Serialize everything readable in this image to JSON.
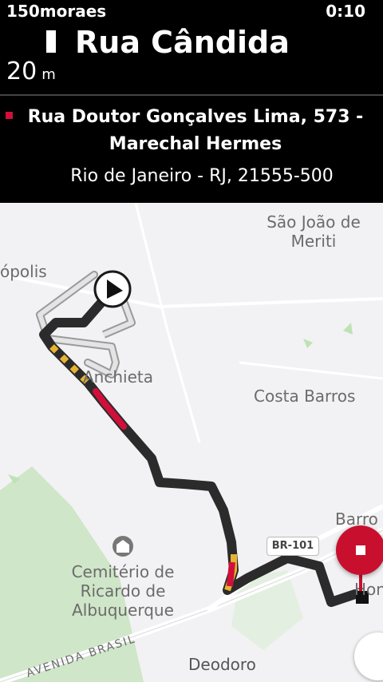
{
  "status_bar": {
    "left_text": "150moraes",
    "right_text": "0:10"
  },
  "navigation": {
    "street": "Rua Cândida",
    "distance_value": "20",
    "distance_unit": "m"
  },
  "destination": {
    "line1": "Rua Doutor Gonçalves Lima, 573 - Marechal Hermes",
    "line2": "Rio de Janeiro - RJ, 21555-500"
  },
  "map": {
    "labels": {
      "sao_joao": "São João de Meriti",
      "opolis": "ópolis",
      "anchieta": "Anchieta",
      "costa_barros": "Costa Barros",
      "barros": "Barro",
      "cemiterio": "Cemitério de Ricardo de Albuquerque",
      "avenida": "AVENIDA BRASIL",
      "deodoro": "Deodoro",
      "hon": "Hon"
    },
    "shield": "BR-101",
    "icons": [
      "navigation-arrow-icon",
      "cemetery-icon",
      "stop-icon",
      "compass-icon",
      "destination-flag-icon"
    ],
    "colors": {
      "route": "#2b2b2b",
      "traffic_heavy": "#d0103a",
      "traffic_medium": "#e8b332",
      "park": "#cfe6c9"
    }
  }
}
